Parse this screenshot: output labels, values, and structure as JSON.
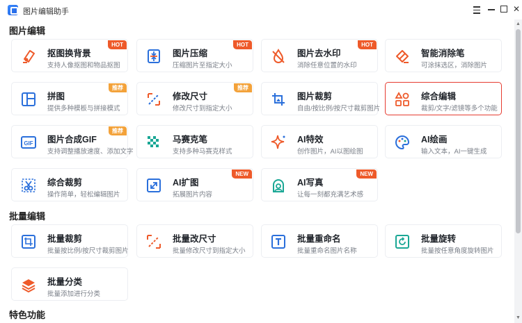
{
  "app": {
    "title": "图片编辑助手"
  },
  "colors": {
    "accent": "#ee5a2a",
    "icon_blue": "#2a6fdb",
    "selected_border": "#e63b30",
    "badge_recommend": "#f3a23a"
  },
  "sections": {
    "image_edit": "图片编辑",
    "batch_edit": "批量编辑",
    "featured": "特色功能"
  },
  "image_edit_tools": [
    {
      "title": "抠图换背景",
      "desc": "支持人像抠图和物品抠图",
      "badge": "HOT",
      "icon": "eraser-icon"
    },
    {
      "title": "图片压缩",
      "desc": "压缩图片至指定大小",
      "badge": "HOT",
      "icon": "compress-icon"
    },
    {
      "title": "图片去水印",
      "desc": "消除任意位置的水印",
      "badge": "HOT",
      "icon": "watermark-drop-icon"
    },
    {
      "title": "智能消除笔",
      "desc": "可涂抹选区，消除图片",
      "badge": "",
      "icon": "magic-eraser-icon"
    },
    {
      "title": "拼图",
      "desc": "提供多种模板与拼接模式",
      "badge": "推荐",
      "icon": "collage-icon"
    },
    {
      "title": "修改尺寸",
      "desc": "修改尺寸到指定大小",
      "badge": "推荐",
      "icon": "resize-icon"
    },
    {
      "title": "图片裁剪",
      "desc": "自由/按比例/按尺寸裁剪图片",
      "badge": "",
      "icon": "crop-icon"
    },
    {
      "title": "综合编辑",
      "desc": "裁剪/文字/滤镜等多个功能",
      "badge": "",
      "icon": "shapes-icon"
    },
    {
      "title": "图片合成GIF",
      "desc": "支持调整播放速度、添加文字",
      "badge": "推荐",
      "icon": "gif-icon"
    },
    {
      "title": "马赛克笔",
      "desc": "支持多种马赛克样式",
      "badge": "",
      "icon": "mosaic-icon"
    },
    {
      "title": "AI特效",
      "desc": "创作图片，AI以图绘图",
      "badge": "",
      "icon": "sparkle-icon"
    },
    {
      "title": "AI绘画",
      "desc": "输入文本，AI一键生成",
      "badge": "",
      "icon": "palette-icon"
    },
    {
      "title": "综合裁剪",
      "desc": "操作简单，轻松编辑图片",
      "badge": "",
      "icon": "scissors-icon"
    },
    {
      "title": "AI扩图",
      "desc": "拓展图片内容",
      "badge": "NEW",
      "icon": "expand-icon"
    },
    {
      "title": "AI写真",
      "desc": "让每一刻都充满艺术感",
      "badge": "NEW",
      "icon": "portrait-icon"
    }
  ],
  "batch_tools": [
    {
      "title": "批量裁剪",
      "desc": "批量按比例/按尺寸裁剪图片",
      "badge": "",
      "icon": "batch-crop-icon"
    },
    {
      "title": "批量改尺寸",
      "desc": "批量修改尺寸到指定大小",
      "badge": "",
      "icon": "batch-resize-icon"
    },
    {
      "title": "批量重命名",
      "desc": "批量重命名图片名称",
      "badge": "",
      "icon": "batch-rename-icon"
    },
    {
      "title": "批量旋转",
      "desc": "批量按任意角度旋转图片",
      "badge": "",
      "icon": "batch-rotate-icon"
    },
    {
      "title": "批量分类",
      "desc": "批量添加进行分类",
      "badge": "",
      "icon": "batch-classify-icon"
    }
  ]
}
